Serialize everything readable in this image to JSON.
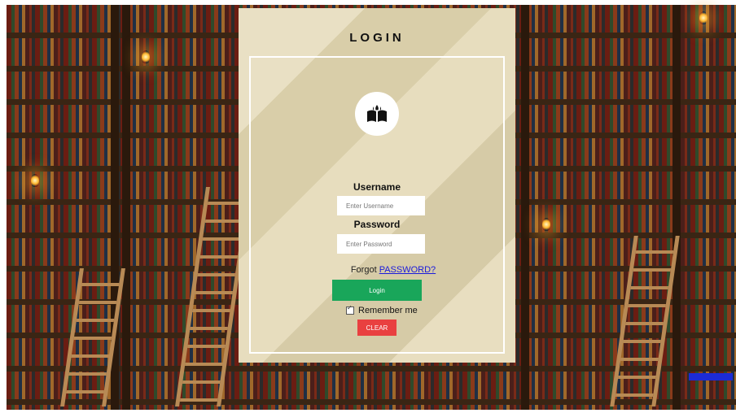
{
  "login": {
    "title": "LOGIN",
    "username_label": "Username",
    "username_placeholder": "Enter Username",
    "password_label": "Password",
    "password_placeholder": "Enter Password",
    "forgot_prefix": "Forgot",
    "forgot_link": "PASSWORD?",
    "login_button": "Login",
    "remember_label": "Remember me",
    "remember_checked": true,
    "clear_button": "CLEAR"
  },
  "icons": {
    "logo": "open-book-icon"
  },
  "colors": {
    "login_button": "#19a65a",
    "clear_button": "#e94040",
    "link": "#1a1adb",
    "panel": "#e2d6b0"
  }
}
